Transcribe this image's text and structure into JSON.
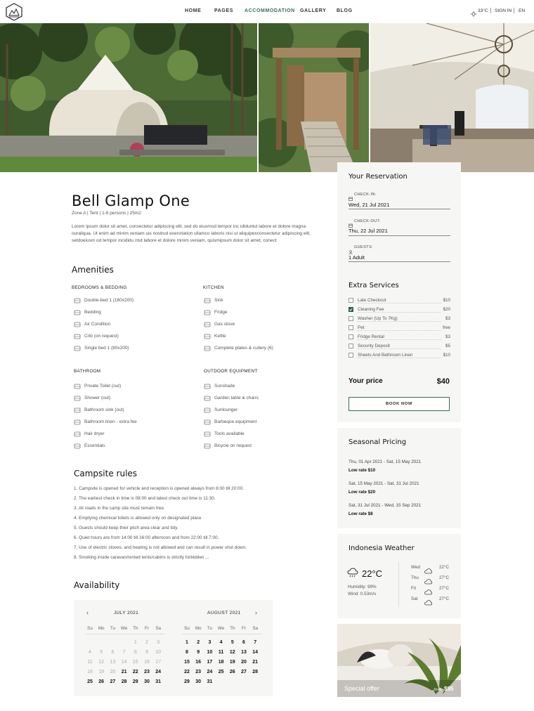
{
  "nav": {
    "items": [
      "HOME",
      "PAGES",
      "ACCOMMODATION",
      "GALLERY",
      "BLOG"
    ],
    "active": "ACCOMMODATION"
  },
  "header_right": {
    "temp": "33°C",
    "sign_in": "SIGN IN",
    "lang": "EN"
  },
  "listing": {
    "title": "Bell Glamp One",
    "meta": "Zone A  |   Tent  |   1-6 persons   |   25m2",
    "description": "Lorem ipsum dolor sit amet, consectetur adipiscing elit, sed do eiusmod tempor inc ididuntut labore et dolore magna ouraliqua. Ut enim ad minim veniam uis nostrud exercitation ullamco laboris nisi ut aliquipexconsectetur adipiscing elit, setdoeiusm od tempor incididu ntut labore et dolore minim veniam, quismipsum dolor sit amet, conect"
  },
  "amenities": {
    "title": "Amenities",
    "groups": [
      {
        "name": "BEDROOMS & BEDDING",
        "items": [
          {
            "icon": "bed-icon",
            "label": "Double-bed  1 (160x200)"
          },
          {
            "icon": "bedding-icon",
            "label": "Bedding"
          },
          {
            "icon": "air-condition-icon",
            "label": "Air Condition"
          },
          {
            "icon": "crib-icon",
            "label": "Crib (on request)"
          },
          {
            "icon": "single-bed-icon",
            "label": "Single bed  1 (80x200)"
          }
        ]
      },
      {
        "name": "KITCHEN",
        "items": [
          {
            "icon": "sink-icon",
            "label": "Sink"
          },
          {
            "icon": "fridge-icon",
            "label": "Fridge"
          },
          {
            "icon": "gas-stove-icon",
            "label": "Gas stove"
          },
          {
            "icon": "kettle-icon",
            "label": "Kettle"
          },
          {
            "icon": "cutlery-icon",
            "label": "Complete plates & cutlery (6)"
          }
        ]
      },
      {
        "name": "BATHROOM",
        "items": [
          {
            "icon": "toilet-icon",
            "label": "Private Toilet (out)"
          },
          {
            "icon": "shower-icon",
            "label": "Shower (out)"
          },
          {
            "icon": "bathroom-sink-icon",
            "label": "Bathroom sink (out)"
          },
          {
            "icon": "bathroom-linen-icon",
            "label": "Bathroom linen - extra fee"
          },
          {
            "icon": "hair-dryer-icon",
            "label": "Hair dryer"
          },
          {
            "icon": "essentials-icon",
            "label": "Essentials"
          }
        ]
      },
      {
        "name": "OUTDOOR EQUIPMENT",
        "items": [
          {
            "icon": "sunshade-icon",
            "label": "Sunshade"
          },
          {
            "icon": "garden-table-icon",
            "label": "Garden table & chairs"
          },
          {
            "icon": "sunlounger-icon",
            "label": "Sunlounger"
          },
          {
            "icon": "barbeque-icon",
            "label": "Barbeque equipment"
          },
          {
            "icon": "tools-icon",
            "label": "Tools available"
          },
          {
            "icon": "bicycle-icon",
            "label": "Bicycle on request"
          }
        ]
      }
    ]
  },
  "rules": {
    "title": "Campsite rules",
    "items": [
      "1. Campsite is opened for vehicle and reception is opened always from 8:00 till 20:00.",
      "2. The earliest check in time is 08:00 and latest check out time is 11:30.",
      "3. All roads in the camp site must remain free.",
      "4. Emptying chemical toilets is allowed only on designated place",
      "5. Guests should keep their pitch area clear and tidy.",
      "6. Quiet hours are from 14:00 till 16:00 afternoon and from 22:00 till 7:00.",
      "7. Use of electric stoves, and heating is not allowed and can result in power shut down.",
      "8. Smoking inside caravan/rented tents/cabins is strictly forbidden ..."
    ]
  },
  "availability": {
    "title": "Availability",
    "weekdays": [
      "Su",
      "Mo",
      "Tu",
      "We",
      "Th",
      "Fr",
      "Sa"
    ],
    "months": [
      {
        "name": "JULY 2021",
        "past": [
          "1",
          "2",
          "3",
          "4",
          "5",
          "6",
          "7",
          "8",
          "9",
          "10",
          "11",
          "12",
          "13",
          "14",
          "15",
          "16",
          "17",
          "18",
          "19",
          "20"
        ],
        "future": [
          "21",
          "22",
          "23",
          "24",
          "25",
          "26",
          "27",
          "28",
          "29",
          "30",
          "31"
        ]
      },
      {
        "name": "AUGUST 2021",
        "past": [],
        "future": [
          "1",
          "2",
          "3",
          "4",
          "5",
          "6",
          "7",
          "8",
          "9",
          "10",
          "11",
          "12",
          "13",
          "14",
          "15",
          "16",
          "17",
          "18",
          "19",
          "20",
          "21",
          "22",
          "23",
          "24",
          "25",
          "26",
          "27",
          "28",
          "29",
          "30",
          "31"
        ]
      }
    ]
  },
  "reservation": {
    "title": "Your Reservation",
    "checkin_label": "CHECK-IN:",
    "checkin_value": "Wed, 21 Jul 2021",
    "checkout_label": "CHECK-OUT:",
    "checkout_value": "Thu, 22 Jul 2021",
    "guests_label": "GUESTS:",
    "guests_value": "1 Adult"
  },
  "extras": {
    "title": "Extra Services",
    "items": [
      {
        "name": "Late Checkout",
        "price": "$10",
        "checked": false
      },
      {
        "name": "Cleaning Fee",
        "price": "$20",
        "checked": true
      },
      {
        "name": "Washer (Up To 7Kg)",
        "price": "$3",
        "checked": false
      },
      {
        "name": "Pet",
        "price": "free",
        "checked": false
      },
      {
        "name": "Fridge Rental",
        "price": "$3",
        "checked": false
      },
      {
        "name": "Security Deposit",
        "price": "$5",
        "checked": false
      },
      {
        "name": "Sheets And Bathroom Linen",
        "price": "$10",
        "checked": false
      }
    ],
    "price_label": "Your price",
    "price_value": "$40",
    "book_label": "BOOK NOW"
  },
  "seasonal": {
    "title": "Seasonal Pricing",
    "periods": [
      {
        "range": "Thu, 01 Apr 2021 - Sat, 15 May 2021",
        "rate": "Low rate $10"
      },
      {
        "range": "Sat, 15 May 2021 - Sat, 31 Jul 2021",
        "rate": "Low rate $20"
      },
      {
        "range": "Sat, 31 Jul 2021 - Wed, 15 Sep 2021",
        "rate": "Low rate $8"
      }
    ]
  },
  "weather": {
    "title": "Indonesia Weather",
    "current_temp": "22°C",
    "humidity": "Humidity: 99%",
    "wind": "Wind: 0.53m/s",
    "forecast": [
      {
        "day": "Wed",
        "temp": "22°C"
      },
      {
        "day": "Thu",
        "temp": "27°C"
      },
      {
        "day": "Fri",
        "temp": "27°C"
      },
      {
        "day": "Sat",
        "temp": "27°C"
      }
    ]
  },
  "special_offer": {
    "label": "Special offer",
    "from": "from",
    "price": "$95"
  },
  "colors": {
    "accent": "#3d6b56",
    "panel": "#f6f6f4"
  }
}
